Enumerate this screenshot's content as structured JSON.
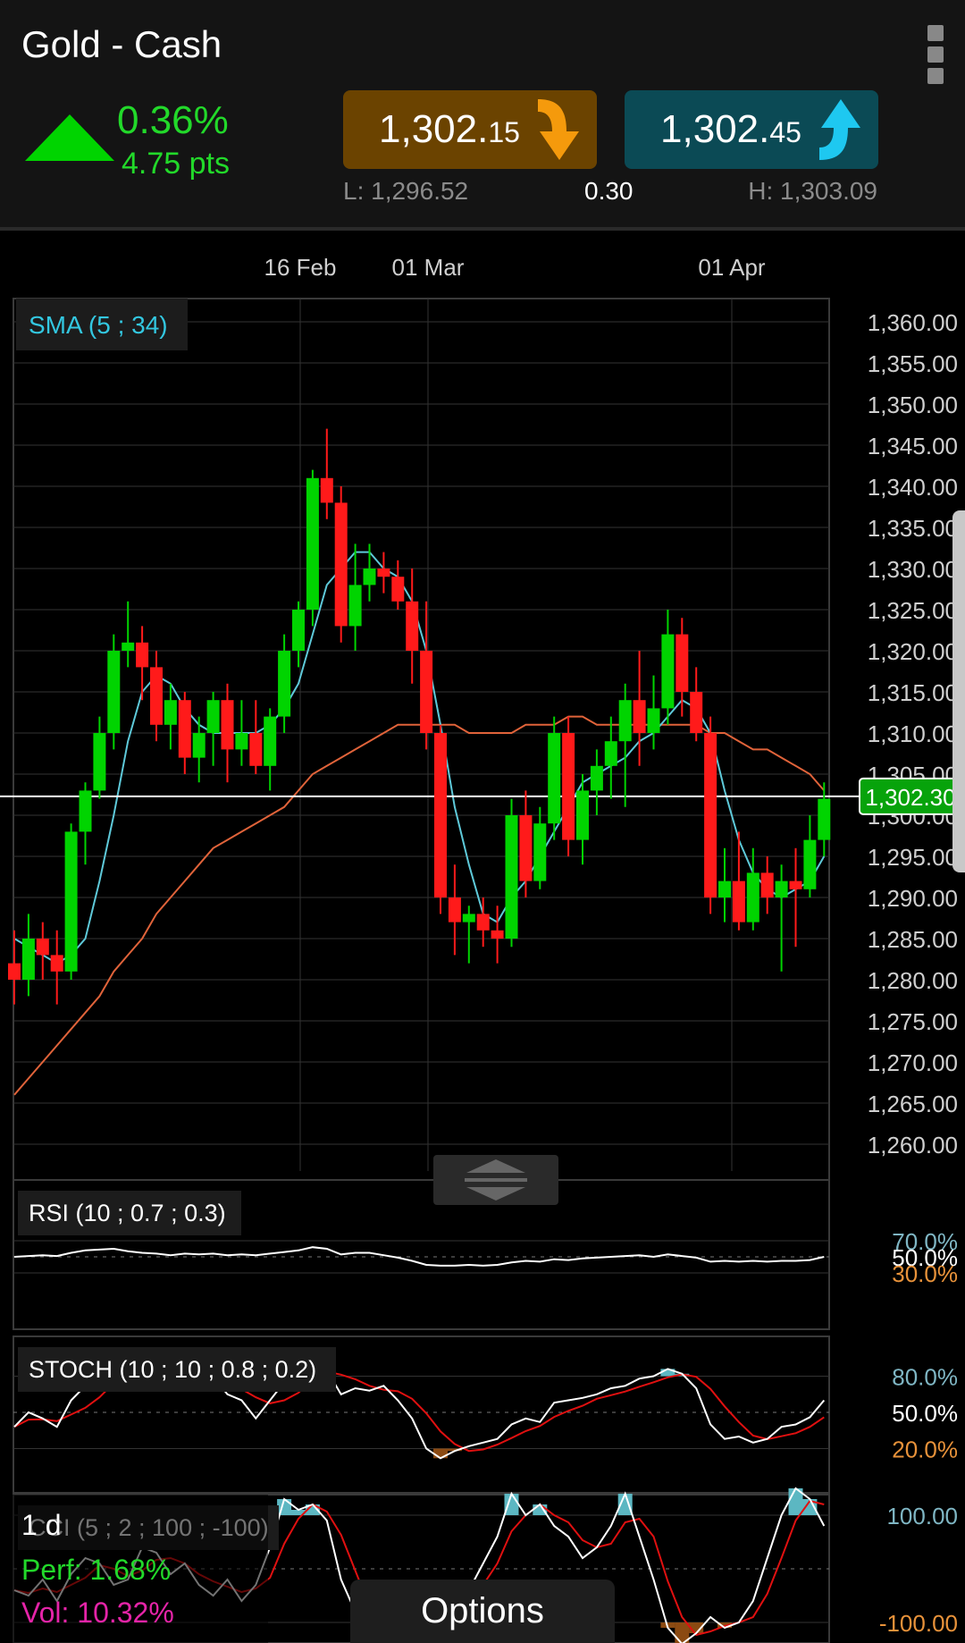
{
  "header": {
    "title": "Gold - Cash",
    "change_pct": "0.36%",
    "change_pts": "4.75 pts",
    "sell": {
      "price_main": "1,302.",
      "price_frac": "15",
      "color": "#6b4300",
      "arrow_color": "#f59a0c",
      "arrow_icon": "arrow-down-icon"
    },
    "buy": {
      "price_main": "1,302.",
      "price_frac": "45",
      "color": "#0b4a55",
      "arrow_color": "#1ec8f0",
      "arrow_icon": "arrow-up-icon"
    },
    "low": "L: 1,296.52",
    "spread": "0.30",
    "high": "H: 1,303.09",
    "menu_icon": "more-vertical-icon"
  },
  "chart": {
    "x_labels": [
      "16 Feb",
      "01 Mar",
      "01 Apr"
    ],
    "price_axis": [
      "1,360.00",
      "1,355.00",
      "1,350.00",
      "1,345.00",
      "1,340.00",
      "1,335.00",
      "1,330.00",
      "1,325.00",
      "1,320.00",
      "1,315.00",
      "1,310.00",
      "1,305.00",
      "1,300.00",
      "1,295.00",
      "1,290.00",
      "1,285.00",
      "1,280.00",
      "1,275.00",
      "1,270.00",
      "1,265.00",
      "1,260.00"
    ],
    "current_price": "1,302.30",
    "sma_label": "SMA (5 ; 34)",
    "colors": {
      "up": "#00d400",
      "down": "#ff1a1a",
      "sma_fast": "#5ec9d9",
      "sma_slow": "#e0633a",
      "grid": "#333333",
      "price_line": "#ffffff"
    },
    "resize_icon": "resize-handle-icon"
  },
  "indicators": {
    "rsi": {
      "label": "RSI (10 ; 0.7 ; 0.3)",
      "levels": [
        "70.0%",
        "50.0%",
        "30.0%"
      ]
    },
    "stoch": {
      "label": "STOCH (10 ; 10 ; 0.8 ; 0.2)",
      "levels": [
        "80.0%",
        "50.0%",
        "20.0%"
      ]
    },
    "cci": {
      "label": "CCI (5 ; 2 ; 100 ; -100)",
      "levels": [
        "100.00",
        "-100.00"
      ]
    }
  },
  "footer": {
    "timeframe": "1 d",
    "perf": "Perf: 1.68%",
    "vol": "Vol: 10.32%",
    "options_label": "Options"
  },
  "chart_data": {
    "type": "candlestick",
    "x_labels": [
      "16 Feb",
      "01 Mar",
      "01 Apr"
    ],
    "ylim": [
      1258,
      1362
    ],
    "y_ticks": [
      1360,
      1355,
      1350,
      1345,
      1340,
      1335,
      1330,
      1325,
      1320,
      1315,
      1310,
      1305,
      1300,
      1295,
      1290,
      1285,
      1280,
      1275,
      1270,
      1265,
      1260
    ],
    "current_price": 1302.3,
    "candles": [
      {
        "o": 1282,
        "h": 1286,
        "l": 1277,
        "c": 1280
      },
      {
        "o": 1280,
        "h": 1288,
        "l": 1278,
        "c": 1285
      },
      {
        "o": 1285,
        "h": 1287,
        "l": 1280,
        "c": 1283
      },
      {
        "o": 1283,
        "h": 1286,
        "l": 1277,
        "c": 1281
      },
      {
        "o": 1281,
        "h": 1299,
        "l": 1280,
        "c": 1298
      },
      {
        "o": 1298,
        "h": 1304,
        "l": 1294,
        "c": 1303
      },
      {
        "o": 1303,
        "h": 1312,
        "l": 1302,
        "c": 1310
      },
      {
        "o": 1310,
        "h": 1322,
        "l": 1308,
        "c": 1320
      },
      {
        "o": 1320,
        "h": 1326,
        "l": 1318,
        "c": 1321
      },
      {
        "o": 1321,
        "h": 1323,
        "l": 1314,
        "c": 1318
      },
      {
        "o": 1318,
        "h": 1320,
        "l": 1309,
        "c": 1311
      },
      {
        "o": 1311,
        "h": 1316,
        "l": 1308,
        "c": 1314
      },
      {
        "o": 1314,
        "h": 1315,
        "l": 1305,
        "c": 1307
      },
      {
        "o": 1307,
        "h": 1312,
        "l": 1304,
        "c": 1310
      },
      {
        "o": 1310,
        "h": 1315,
        "l": 1306,
        "c": 1314
      },
      {
        "o": 1314,
        "h": 1316,
        "l": 1304,
        "c": 1308
      },
      {
        "o": 1308,
        "h": 1314,
        "l": 1306,
        "c": 1310
      },
      {
        "o": 1310,
        "h": 1314,
        "l": 1305,
        "c": 1306
      },
      {
        "o": 1306,
        "h": 1313,
        "l": 1303,
        "c": 1312
      },
      {
        "o": 1312,
        "h": 1322,
        "l": 1310,
        "c": 1320
      },
      {
        "o": 1320,
        "h": 1326,
        "l": 1318,
        "c": 1325
      },
      {
        "o": 1325,
        "h": 1342,
        "l": 1323,
        "c": 1341
      },
      {
        "o": 1341,
        "h": 1347,
        "l": 1336,
        "c": 1338
      },
      {
        "o": 1338,
        "h": 1340,
        "l": 1321,
        "c": 1323
      },
      {
        "o": 1323,
        "h": 1333,
        "l": 1320,
        "c": 1328
      },
      {
        "o": 1328,
        "h": 1333,
        "l": 1326,
        "c": 1330
      },
      {
        "o": 1330,
        "h": 1332,
        "l": 1327,
        "c": 1329
      },
      {
        "o": 1329,
        "h": 1331,
        "l": 1325,
        "c": 1326
      },
      {
        "o": 1326,
        "h": 1330,
        "l": 1316,
        "c": 1320
      },
      {
        "o": 1320,
        "h": 1326,
        "l": 1308,
        "c": 1310
      },
      {
        "o": 1310,
        "h": 1311,
        "l": 1288,
        "c": 1290
      },
      {
        "o": 1290,
        "h": 1294,
        "l": 1283,
        "c": 1287
      },
      {
        "o": 1287,
        "h": 1289,
        "l": 1282,
        "c": 1288
      },
      {
        "o": 1288,
        "h": 1290,
        "l": 1284,
        "c": 1286
      },
      {
        "o": 1286,
        "h": 1289,
        "l": 1282,
        "c": 1285
      },
      {
        "o": 1285,
        "h": 1302,
        "l": 1284,
        "c": 1300
      },
      {
        "o": 1300,
        "h": 1303,
        "l": 1290,
        "c": 1292
      },
      {
        "o": 1292,
        "h": 1301,
        "l": 1291,
        "c": 1299
      },
      {
        "o": 1299,
        "h": 1312,
        "l": 1297,
        "c": 1310
      },
      {
        "o": 1310,
        "h": 1312,
        "l": 1295,
        "c": 1297
      },
      {
        "o": 1297,
        "h": 1305,
        "l": 1294,
        "c": 1303
      },
      {
        "o": 1303,
        "h": 1308,
        "l": 1300,
        "c": 1306
      },
      {
        "o": 1306,
        "h": 1312,
        "l": 1302,
        "c": 1309
      },
      {
        "o": 1309,
        "h": 1316,
        "l": 1301,
        "c": 1314
      },
      {
        "o": 1314,
        "h": 1320,
        "l": 1306,
        "c": 1310
      },
      {
        "o": 1310,
        "h": 1317,
        "l": 1308,
        "c": 1313
      },
      {
        "o": 1313,
        "h": 1325,
        "l": 1311,
        "c": 1322
      },
      {
        "o": 1322,
        "h": 1324,
        "l": 1312,
        "c": 1315
      },
      {
        "o": 1315,
        "h": 1318,
        "l": 1309,
        "c": 1310
      },
      {
        "o": 1310,
        "h": 1312,
        "l": 1288,
        "c": 1290
      },
      {
        "o": 1290,
        "h": 1296,
        "l": 1287,
        "c": 1292
      },
      {
        "o": 1292,
        "h": 1298,
        "l": 1286,
        "c": 1287
      },
      {
        "o": 1287,
        "h": 1296,
        "l": 1286,
        "c": 1293
      },
      {
        "o": 1293,
        "h": 1295,
        "l": 1288,
        "c": 1290
      },
      {
        "o": 1290,
        "h": 1294,
        "l": 1281,
        "c": 1292
      },
      {
        "o": 1292,
        "h": 1296,
        "l": 1284,
        "c": 1291
      },
      {
        "o": 1291,
        "h": 1300,
        "l": 1290,
        "c": 1297
      },
      {
        "o": 1297,
        "h": 1304,
        "l": 1295,
        "c": 1302
      }
    ],
    "sma_fast": [
      1285,
      1284,
      1283,
      1282,
      1283,
      1285,
      1292,
      1300,
      1309,
      1315,
      1317,
      1316,
      1313,
      1311,
      1310,
      1310,
      1310,
      1310,
      1311,
      1313,
      1316,
      1322,
      1328,
      1330,
      1332,
      1332,
      1330,
      1329,
      1326,
      1320,
      1311,
      1301,
      1294,
      1288,
      1287,
      1290,
      1292,
      1295,
      1298,
      1301,
      1304,
      1305,
      1306,
      1307,
      1309,
      1310,
      1312,
      1314,
      1313,
      1310,
      1303,
      1297,
      1293,
      1291,
      1290,
      1291,
      1292,
      1295
    ],
    "sma_slow": [
      1266,
      1268,
      1270,
      1272,
      1274,
      1276,
      1278,
      1281,
      1283,
      1285,
      1288,
      1290,
      1292,
      1294,
      1296,
      1297,
      1298,
      1299,
      1300,
      1301,
      1303,
      1305,
      1306,
      1307,
      1308,
      1309,
      1310,
      1311,
      1311,
      1311,
      1311,
      1311,
      1310,
      1310,
      1310,
      1310,
      1311,
      1311,
      1311,
      1312,
      1312,
      1311,
      1311,
      1311,
      1311,
      1311,
      1311,
      1311,
      1311,
      1310,
      1310,
      1309,
      1308,
      1308,
      1307,
      1306,
      1305,
      1303
    ],
    "rsi": [
      50,
      51,
      52,
      51,
      55,
      58,
      59,
      60,
      57,
      55,
      54,
      52,
      54,
      53,
      54,
      52,
      53,
      52,
      54,
      56,
      58,
      62,
      60,
      53,
      55,
      55,
      52,
      49,
      45,
      40,
      39,
      39,
      40,
      39,
      40,
      43,
      45,
      44,
      47,
      46,
      48,
      49,
      50,
      51,
      52,
      50,
      53,
      51,
      49,
      44,
      45,
      44,
      45,
      44,
      45,
      45,
      46,
      50
    ],
    "stoch": [
      38,
      50,
      45,
      38,
      60,
      72,
      80,
      85,
      88,
      86,
      80,
      75,
      70,
      72,
      80,
      65,
      60,
      45,
      60,
      75,
      85,
      90,
      85,
      65,
      70,
      68,
      72,
      60,
      45,
      20,
      12,
      18,
      22,
      25,
      28,
      40,
      45,
      42,
      58,
      60,
      62,
      65,
      70,
      72,
      78,
      80,
      86,
      82,
      70,
      40,
      28,
      30,
      25,
      28,
      38,
      40,
      46,
      60
    ],
    "cci": [
      -40,
      -50,
      -20,
      -60,
      -10,
      20,
      10,
      -30,
      -20,
      40,
      30,
      -10,
      10,
      -30,
      -50,
      -20,
      -60,
      -30,
      40,
      130,
      110,
      120,
      90,
      -20,
      -80,
      -110,
      -90,
      -120,
      -140,
      -110,
      -70,
      -60,
      -40,
      10,
      60,
      140,
      100,
      120,
      80,
      60,
      20,
      40,
      80,
      140,
      60,
      -20,
      -110,
      -140,
      -120,
      -90,
      -110,
      -100,
      -60,
      20,
      100,
      150,
      130,
      80
    ]
  }
}
